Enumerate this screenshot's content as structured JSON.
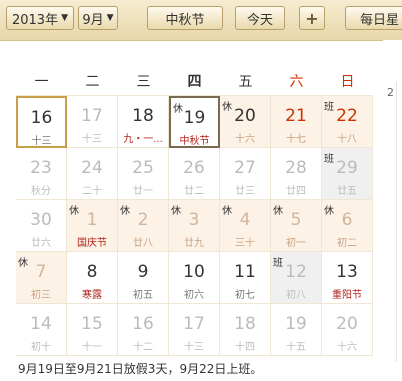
{
  "toolbar": {
    "year": "2013年",
    "month": "9月",
    "festival": "中秋节",
    "today": "今天",
    "add": "+",
    "daily": "每日星"
  },
  "sidebar_peek": "2",
  "weekdays": [
    "一",
    "二",
    "三",
    "四",
    "五",
    "六",
    "日"
  ],
  "cells": [
    {
      "d": "16",
      "l": "十三",
      "tag": "",
      "k": "sel"
    },
    {
      "d": "17",
      "l": "十三",
      "tag": "",
      "k": "other"
    },
    {
      "d": "18",
      "l": "九・一...",
      "tag": "",
      "k": ""
    },
    {
      "d": "19",
      "l": "中秋节",
      "tag": "休",
      "k": "hol"
    },
    {
      "d": "20",
      "l": "十六",
      "tag": "休",
      "k": "hol"
    },
    {
      "d": "21",
      "l": "十七",
      "tag": "",
      "k": "hol weekend"
    },
    {
      "d": "22",
      "l": "十八",
      "tag": "班",
      "k": "hol weekend"
    },
    {
      "d": "23",
      "l": "秋分",
      "tag": "",
      "k": "other"
    },
    {
      "d": "24",
      "l": "二十",
      "tag": "",
      "k": "other"
    },
    {
      "d": "25",
      "l": "廿一",
      "tag": "",
      "k": "other"
    },
    {
      "d": "26",
      "l": "廿二",
      "tag": "",
      "k": "other"
    },
    {
      "d": "27",
      "l": "廿三",
      "tag": "",
      "k": "other"
    },
    {
      "d": "28",
      "l": "廿四",
      "tag": "",
      "k": "other"
    },
    {
      "d": "29",
      "l": "廿五",
      "tag": "班",
      "k": "work other"
    },
    {
      "d": "30",
      "l": "廿六",
      "tag": "",
      "k": "other"
    },
    {
      "d": "1",
      "l": "国庆节",
      "tag": "休",
      "k": "hol"
    },
    {
      "d": "2",
      "l": "廿八",
      "tag": "休",
      "k": "hol"
    },
    {
      "d": "3",
      "l": "廿九",
      "tag": "休",
      "k": "hol"
    },
    {
      "d": "4",
      "l": "三十",
      "tag": "休",
      "k": "hol"
    },
    {
      "d": "5",
      "l": "初一",
      "tag": "休",
      "k": "hol"
    },
    {
      "d": "6",
      "l": "初二",
      "tag": "休",
      "k": "hol"
    },
    {
      "d": "7",
      "l": "初三",
      "tag": "休",
      "k": "hol"
    },
    {
      "d": "8",
      "l": "寒露",
      "tag": "",
      "k": "fest"
    },
    {
      "d": "9",
      "l": "初五",
      "tag": "",
      "k": ""
    },
    {
      "d": "10",
      "l": "初六",
      "tag": "",
      "k": ""
    },
    {
      "d": "11",
      "l": "初七",
      "tag": "",
      "k": ""
    },
    {
      "d": "12",
      "l": "初八",
      "tag": "班",
      "k": "work other"
    },
    {
      "d": "13",
      "l": "重阳节",
      "tag": "",
      "k": "fest"
    },
    {
      "d": "14",
      "l": "初十",
      "tag": "",
      "k": "other"
    },
    {
      "d": "15",
      "l": "十一",
      "tag": "",
      "k": "other"
    },
    {
      "d": "16",
      "l": "十二",
      "tag": "",
      "k": "other"
    },
    {
      "d": "17",
      "l": "十三",
      "tag": "",
      "k": "other"
    },
    {
      "d": "18",
      "l": "十四",
      "tag": "",
      "k": "other"
    },
    {
      "d": "19",
      "l": "十五",
      "tag": "",
      "k": "other"
    },
    {
      "d": "20",
      "l": "十六",
      "tag": "",
      "k": "other"
    }
  ],
  "footer": "9月19日至9月21日放假3天，9月22日上班。"
}
